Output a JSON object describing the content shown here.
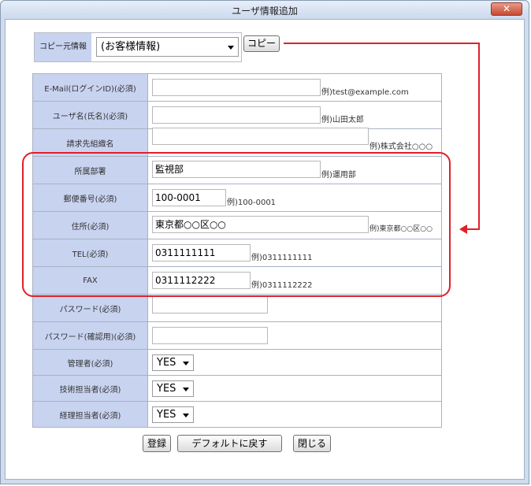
{
  "window": {
    "title": "ユーザ情報追加",
    "close_label": "✕"
  },
  "copy_source": {
    "label": "コピー元情報",
    "selected": "(お客様情報)",
    "copy_button": "コピー"
  },
  "fields": {
    "email": {
      "label": "E-Mail(ログインID)(必須)",
      "value": "",
      "example": "例)test@example.com"
    },
    "username": {
      "label": "ユーザ名(氏名)(必須)",
      "value": "",
      "example": "例)山田太郎"
    },
    "billing": {
      "label": "請求先組織名",
      "value": "",
      "example": "例)株式会社○○○"
    },
    "department": {
      "label": "所属部署",
      "value": "監視部",
      "example": "例)運用部"
    },
    "postal": {
      "label": "郵便番号(必須)",
      "value": "100-0001",
      "example": "例)100-0001"
    },
    "address": {
      "label": "住所(必須)",
      "value": "東京都○○区○○",
      "example": "例)東京都○○区○○"
    },
    "tel": {
      "label": "TEL(必須)",
      "value": "0311111111",
      "example": "例)0311111111"
    },
    "fax": {
      "label": "FAX",
      "value": "0311112222",
      "example": "例)0311112222"
    },
    "password": {
      "label": "パスワード(必須)",
      "value": ""
    },
    "password_confirm": {
      "label": "パスワード(確認用)(必須)",
      "value": ""
    },
    "admin": {
      "label": "管理者(必須)",
      "value": "YES"
    },
    "tech_contact": {
      "label": "技術担当者(必須)",
      "value": "YES"
    },
    "billing_contact": {
      "label": "経理担当者(必須)",
      "value": "YES"
    }
  },
  "buttons": {
    "register": "登録",
    "reset_default": "デフォルトに戻す",
    "close": "閉じる"
  },
  "colors": {
    "label_bg": "#c8d3f0",
    "annotation": "#e0202a",
    "frame": "#cfdcee"
  }
}
